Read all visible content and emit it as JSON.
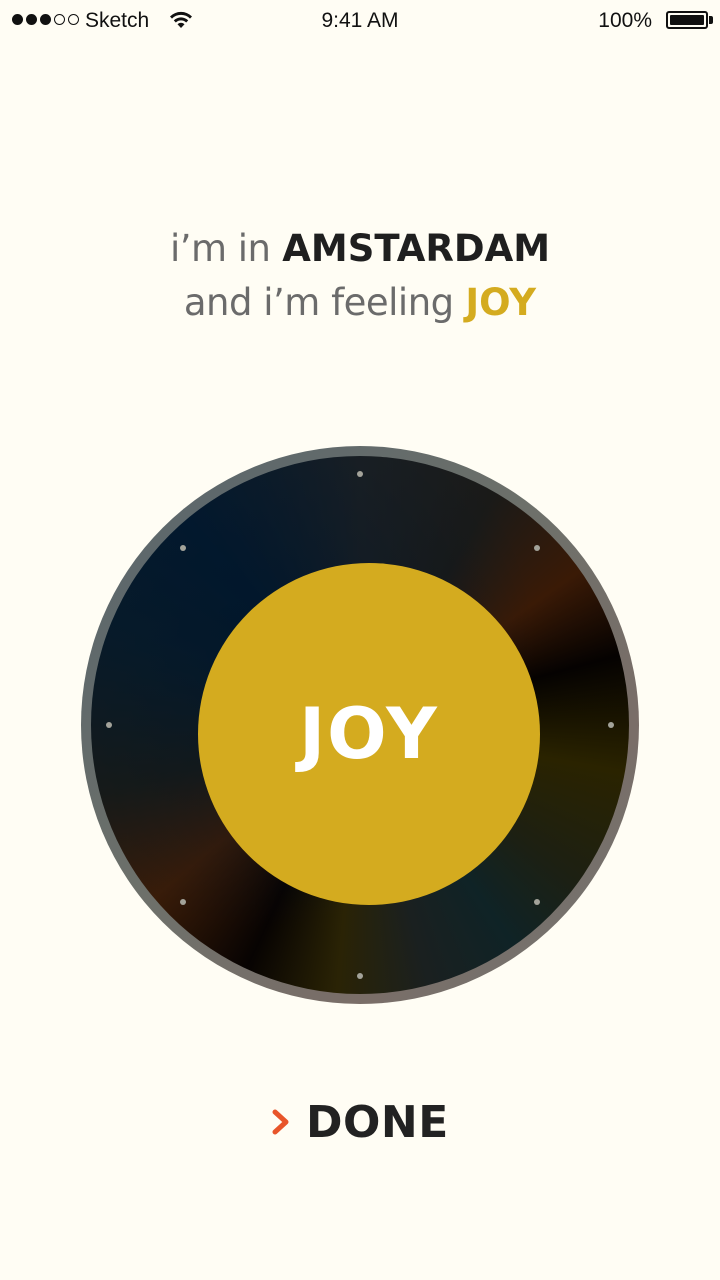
{
  "status_bar": {
    "carrier": "Sketch",
    "time": "9:41 AM",
    "battery_percent": "100%",
    "battery_level": 1.0,
    "signal_bars_filled": 3,
    "signal_bars_total": 5
  },
  "headline": {
    "line1_prefix": "i’m in",
    "city": "AMSTARDAM",
    "line2_prefix": "and i’m feeling",
    "feeling": "JOY"
  },
  "dial": {
    "center_label": "JOY",
    "tick_count": 8
  },
  "done_button": {
    "label": "DONE",
    "chevron_icon": "chevron-right-icon"
  },
  "colors": {
    "background": "#fffdf4",
    "accent_yellow": "#d4ab1f",
    "chevron_orange": "#e8552a",
    "text_dark": "#1f1f1f",
    "text_gray": "#6b6b6b"
  }
}
